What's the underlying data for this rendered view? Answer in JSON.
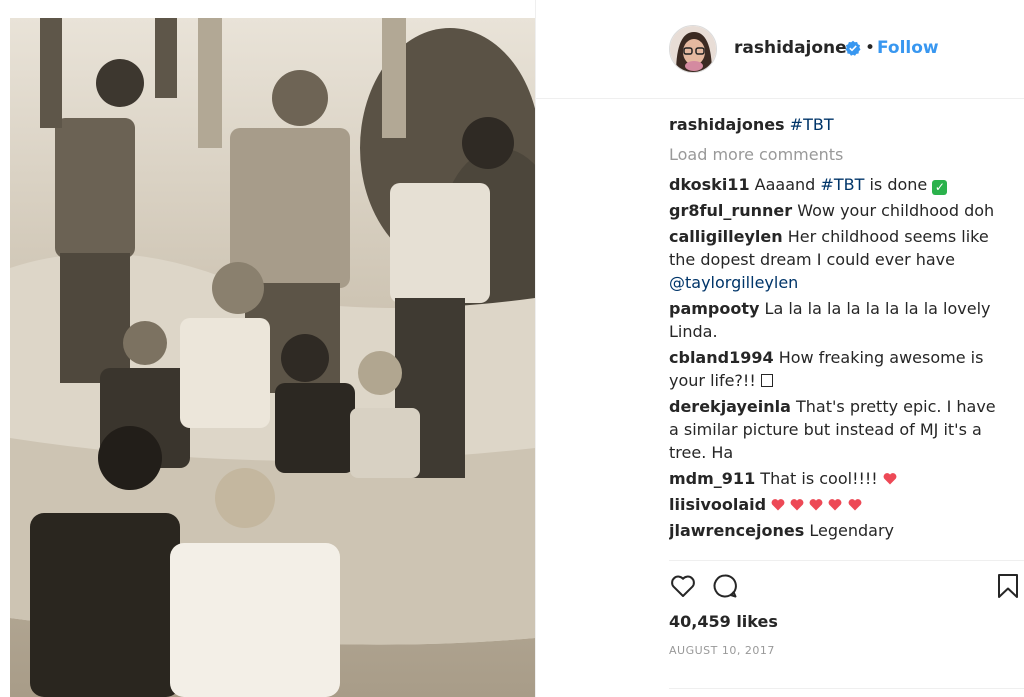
{
  "post": {
    "photo_alt": "Vintage black and white group photo"
  },
  "header": {
    "username": "rashidajones",
    "separator": "•",
    "follow_label": "Follow"
  },
  "caption": {
    "username": "rashidajones",
    "tag": "#TBT"
  },
  "load_more": "Load more comments",
  "comments": [
    {
      "user": "dkoski11",
      "text": "Aaaand ",
      "tag": "#TBT",
      "suffix": " is done",
      "emoji": "check"
    },
    {
      "user": "gr8ful_runner",
      "text": "Wow your childhood doh"
    },
    {
      "user": "calligilleylen",
      "text": "Her childhood seems like the dopest dream I could ever have ",
      "mention": "@taylorgilleylen"
    },
    {
      "user": "pampooty",
      "text": "La la la la la la la la la lovely Linda."
    },
    {
      "user": "cbland1994",
      "text": "How freaking awesome is your life?!! ",
      "emoji": "box"
    },
    {
      "user": "derekjayeinla",
      "text": "That's pretty epic. I have a similar picture but instead of MJ it's a tree. Ha"
    },
    {
      "user": "mdm_911",
      "text": "That is cool!!!! ",
      "hearts": 1
    },
    {
      "user": "liisivoolaid",
      "text": "",
      "hearts": 5
    },
    {
      "user": "jlawrencejones",
      "text": "Legendary"
    }
  ],
  "likes": "40,459 likes",
  "date": "AUGUST 10, 2017",
  "colors": {
    "link": "#003569",
    "follow": "#3897f0",
    "verified": "#3897f0",
    "heart": "#ed4956",
    "muted": "#999999"
  },
  "icons": {
    "like": "heart-outline-icon",
    "comment": "speech-bubble-icon",
    "save": "bookmark-icon",
    "verified": "verified-badge-icon"
  }
}
